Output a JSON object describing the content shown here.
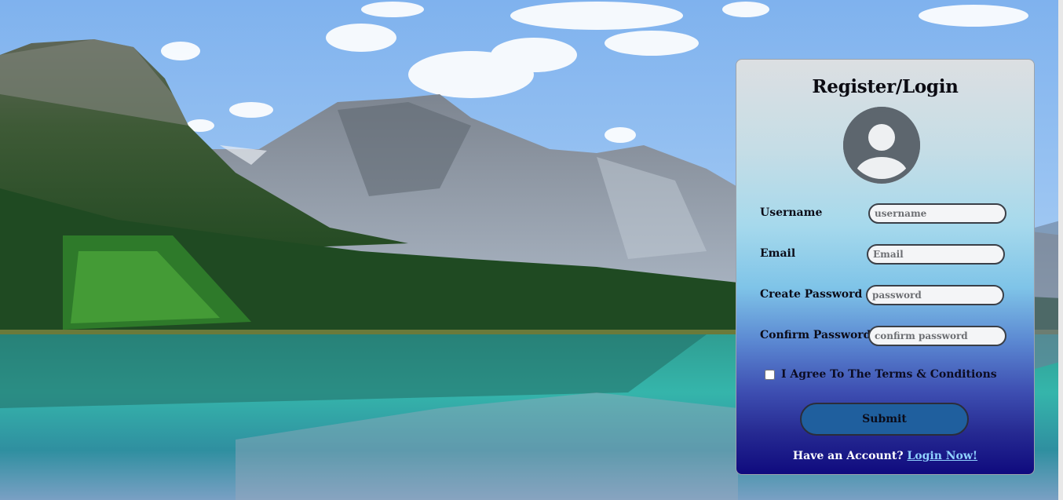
{
  "form": {
    "title": "Register/Login",
    "fields": [
      {
        "label": "Username",
        "placeholder": "username",
        "value": ""
      },
      {
        "label": "Email",
        "placeholder": "Email",
        "value": ""
      },
      {
        "label": "Create Password",
        "placeholder": "password",
        "value": ""
      },
      {
        "label": "Confirm Password",
        "placeholder": "confirm password",
        "value": ""
      }
    ],
    "terms_label": "I Agree To The Terms & Conditions",
    "terms_checked": false,
    "submit_label": "Submit",
    "footer_text": "Have an Account?",
    "login_link_label": "Login Now!"
  },
  "icons": {
    "avatar": "user-avatar-icon"
  },
  "colors": {
    "submit_button": "#1f5f9e",
    "link": "#8fd1ff",
    "avatar": "#5d666e"
  }
}
